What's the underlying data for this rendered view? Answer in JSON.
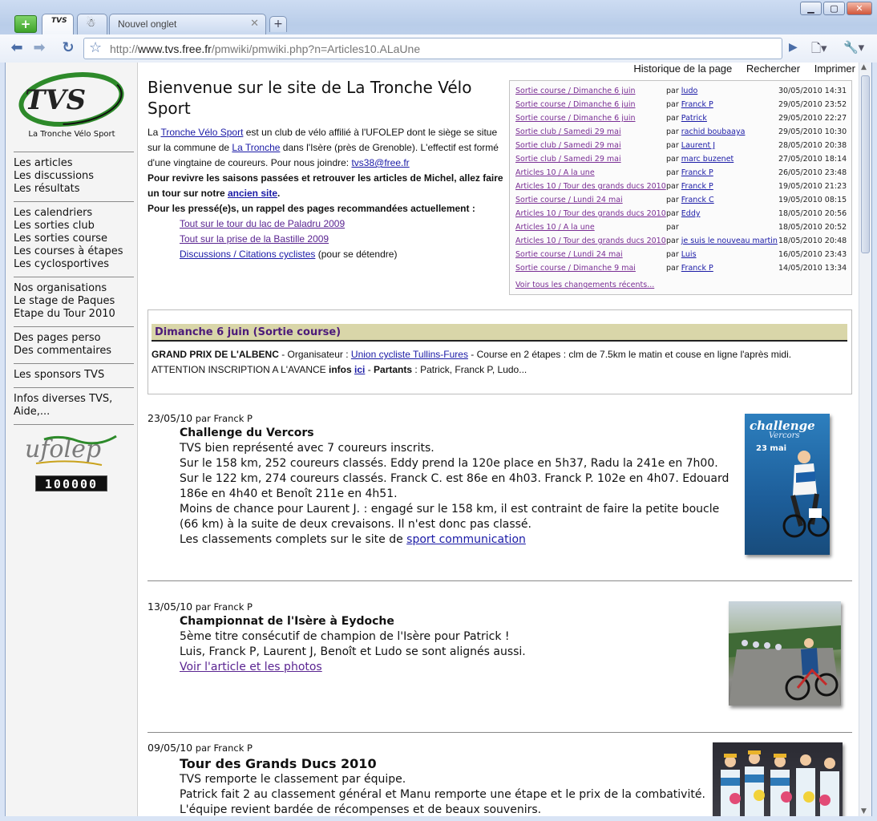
{
  "browser": {
    "tabs": [
      {
        "label": ""
      },
      {
        "label": "TVS"
      },
      {
        "label": ""
      },
      {
        "label": "Nouvel onglet"
      }
    ],
    "url_prefix": "http://",
    "url_host": "www.tvs.free.fr",
    "url_path": "/pmwiki/pmwiki.php?n=Articles10.ALaUne"
  },
  "top_actions": [
    "Historique de la page",
    "Rechercher",
    "Imprimer"
  ],
  "sidebar": {
    "logo_caption": "La Tronche Vélo Sport",
    "groups": [
      [
        "Les articles",
        "Les discussions",
        "Les résultats"
      ],
      [
        "Les calendriers",
        "Les sorties club",
        "Les sorties course",
        "Les courses à étapes",
        "Les cyclosportives"
      ],
      [
        "Nos organisations",
        "Le stage de Paques",
        "Etape du Tour 2010"
      ],
      [
        "Des pages perso",
        "Des commentaires"
      ],
      [
        "Les sponsors TVS"
      ],
      [
        "Infos diverses TVS,",
        "Aide,..."
      ]
    ],
    "counter": "100000"
  },
  "welcome": {
    "title": "Bienvenue sur le site de La Tronche Vélo Sport",
    "p1_a": "La ",
    "p1_link1": "Tronche Vélo Sport",
    "p1_b": " est un club de vélo affilié à l'UFOLEP dont le siège se situe sur la commune de ",
    "p1_link2": "La Tronche",
    "p1_c": " dans l'Isère (près de Grenoble). L'effectif est formé d'une vingtaine de coureurs. Pour nous joindre: ",
    "p1_email": "tvs38@free.fr",
    "p2_a": "Pour revivre les saisons passées et retrouver les articles de Michel, allez faire un tour sur notre ",
    "p2_link": "ancien site",
    "p2_b": ".",
    "p3": "Pour les pressé(e)s, un rappel des pages recommandées actuellement :",
    "rec1": "Tout sur le tour du lac de Paladru 2009",
    "rec2": "Tout sur la prise de la Bastille 2009",
    "rec3": "Discussions / Citations cyclistes",
    "rec3_suffix": " (pour se détendre)"
  },
  "recent_changes": {
    "rows": [
      {
        "title": "Sortie course / Dimanche 6 juin",
        "par": "par ",
        "author": "ludo",
        "date": "30/05/2010 14:31"
      },
      {
        "title": "Sortie course / Dimanche 6 juin",
        "par": "par ",
        "author": "Franck P",
        "date": "29/05/2010 23:52"
      },
      {
        "title": "Sortie course / Dimanche 6 juin",
        "par": "par ",
        "author": "Patrick",
        "date": "29/05/2010 22:27"
      },
      {
        "title": "Sortie club / Samedi 29 mai",
        "par": "par ",
        "author": "rachid boubaaya",
        "date": "29/05/2010 10:30"
      },
      {
        "title": "Sortie club / Samedi 29 mai",
        "par": "par ",
        "author": "Laurent J",
        "date": "28/05/2010 20:38"
      },
      {
        "title": "Sortie club / Samedi 29 mai",
        "par": "par ",
        "author": "marc buzenet",
        "date": "27/05/2010 18:14"
      },
      {
        "title": "Articles 10 / A la une",
        "par": "par ",
        "author": "Franck P",
        "date": "26/05/2010 23:48"
      },
      {
        "title": "Articles 10 / Tour des grands ducs 2010",
        "par": "par ",
        "author": "Franck P",
        "date": "19/05/2010 21:23"
      },
      {
        "title": "Sortie course / Lundi 24 mai",
        "par": "par ",
        "author": "Franck C",
        "date": "19/05/2010 08:15"
      },
      {
        "title": "Articles 10 / Tour des grands ducs 2010",
        "par": "par ",
        "author": "Eddy",
        "date": "18/05/2010 20:56"
      },
      {
        "title": "Articles 10 / A la une",
        "par": "par",
        "author": "",
        "date": "18/05/2010 20:52"
      },
      {
        "title": "Articles 10 / Tour des grands ducs 2010",
        "par": "par ",
        "author": "je suis le nouveau martin",
        "date": "18/05/2010 20:48"
      },
      {
        "title": "Sortie course / Lundi 24 mai",
        "par": "par ",
        "author": "Luis",
        "date": "16/05/2010 23:43"
      },
      {
        "title": "Sortie course / Dimanche 9 mai",
        "par": "par ",
        "author": "Franck P",
        "date": "14/05/2010 13:34"
      }
    ],
    "all_link": "Voir tous les changements récents..."
  },
  "event": {
    "header": "Dimanche 6 juin (Sortie course)",
    "name": "GRAND PRIX DE L'ALBENC",
    "a": " - Organisateur : ",
    "org": "Union cycliste Tullins-Fures",
    "b": " - Course en 2 étapes : clm de 7.5km le matin et couse en ligne l'après midi.",
    "c": "ATTENTION INSCRIPTION A L'AVANCE ",
    "infos": "infos",
    "ici": "ici",
    "d": " - ",
    "partants_label": "Partants",
    "partants": " : Patrick, Franck P, Ludo..."
  },
  "articles": [
    {
      "date": "23/05/10",
      "par": " par Franck P",
      "title": "Challenge du Vercors",
      "lines": [
        "TVS bien représenté avec 7 coureurs inscrits.",
        "Sur le 158 km, 252 coureurs classés. Eddy prend la 120e place en 5h37, Radu la 241e en 7h00.",
        "Sur le 122 km, 274 coureurs classés. Franck C. est 86e en 4h03. Franck P. 102e en 4h07. Edouard 186e en 4h40 et Benoît 211e en 4h51.",
        "Moins de chance pour Laurent J. : engagé sur le 158 km, il est contraint de faire la petite boucle (66 km) à la suite de deux crevaisons. Il n'est donc pas classé."
      ],
      "last_a": "Les classements complets sur le site de ",
      "last_link": "sport communication",
      "poster_title": "challenge",
      "poster_sub": "Vercors",
      "poster_date": "23 mai"
    },
    {
      "date": "13/05/10",
      "par": " par Franck P",
      "title": "Championnat de l'Isère à Eydoche",
      "lines": [
        "5ème titre consécutif de champion de l'Isère pour Patrick !",
        "Luis, Franck P, Laurent J, Benoît et Ludo se sont alignés aussi."
      ],
      "link": "Voir l'article et les photos"
    },
    {
      "date": "09/05/10",
      "par": " par Franck P",
      "title": "Tour des Grands Ducs 2010",
      "lines": [
        "TVS remporte le classement par équipe.",
        "Patrick fait 2 au classement général et Manu remporte une étape et le prix de la combativité.",
        "L'équipe revient bardée de récompenses et de beaux souvenirs."
      ]
    }
  ]
}
